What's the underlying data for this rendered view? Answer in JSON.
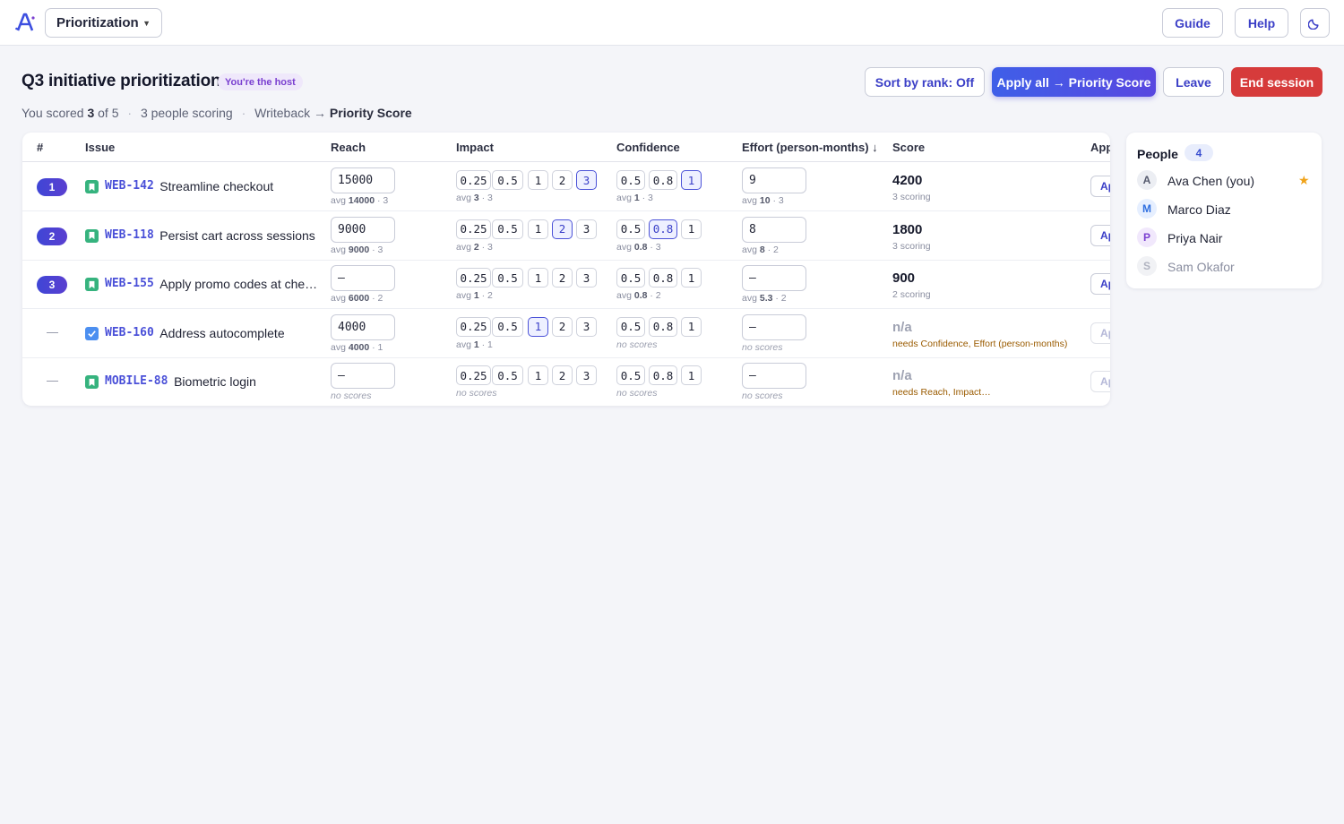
{
  "app": {
    "project_select": "Prioritization",
    "guide_label": "Guide",
    "help_label": "Help",
    "logo_icon": "app-logo-icon",
    "theme_icon": "moon-icon"
  },
  "header": {
    "title": "Q3 initiative prioritization",
    "host_badge": "You're the host",
    "scored_prefix": "You scored",
    "scored_count": "3",
    "scored_suffix": "of 5",
    "people_scoring": "3 people scoring",
    "writeback_label": "Writeback →",
    "writeback_target": "Priority Score",
    "sort_label": "Sort by rank: Off",
    "apply_label": "Apply all → Priority Score",
    "leave_label": "Leave",
    "end_label": "End session"
  },
  "table": {
    "columns": [
      "#",
      "Issue",
      "Reach",
      "Impact",
      "Confidence",
      "Effort (person-months) ↓",
      "Score",
      "App"
    ],
    "impact_options": [
      "0.25",
      "0.5",
      "1",
      "2",
      "3"
    ],
    "confidence_options": [
      "0.5",
      "0.8",
      "1"
    ],
    "apply_label": "Ap",
    "rows": [
      {
        "rank": "1",
        "type": "story",
        "key": "WEB-142",
        "title": "Streamline checkout",
        "reach": "15000",
        "reach_avg": "14000",
        "reach_n": "· 3",
        "impact_sel": 4,
        "impact_avg": "3",
        "impact_n": "· 3",
        "conf_sel": 2,
        "conf_avg": "1",
        "conf_n": "· 3",
        "effort": "9",
        "effort_avg": "10",
        "effort_n": "· 3",
        "score": "4200",
        "score_sub": "3 scoring",
        "score_warn": false
      },
      {
        "rank": "2",
        "type": "story",
        "key": "WEB-118",
        "title": "Persist cart across sessions",
        "reach": "9000",
        "reach_avg": "9000",
        "reach_n": "· 3",
        "impact_sel": 3,
        "impact_avg": "2",
        "impact_n": "· 3",
        "conf_sel": 1,
        "conf_avg": "0.8",
        "conf_n": "· 3",
        "effort": "8",
        "effort_avg": "8",
        "effort_n": "· 2",
        "score": "1800",
        "score_sub": "3 scoring",
        "score_warn": false
      },
      {
        "rank": "3",
        "type": "story",
        "key": "WEB-155",
        "title": "Apply promo codes at che…",
        "reach": "–",
        "reach_avg": "6000",
        "reach_n": "· 2",
        "impact_sel": -1,
        "impact_avg": "1",
        "impact_n": "· 2",
        "conf_sel": -1,
        "conf_avg": "0.8",
        "conf_n": "· 2",
        "effort": "–",
        "effort_avg": "5.3",
        "effort_n": "· 2",
        "score": "900",
        "score_sub": "2 scoring",
        "score_warn": false
      },
      {
        "rank": "—",
        "type": "task",
        "key": "WEB-160",
        "title": "Address autocomplete",
        "reach": "4000",
        "reach_avg": "4000",
        "reach_n": "· 1",
        "impact_sel": 2,
        "impact_avg": "1",
        "impact_n": "· 1",
        "conf_sel": -1,
        "conf_none": "no scores",
        "effort": "–",
        "effort_none": "no scores",
        "score": "n/a",
        "score_sub": "needs Confidence, Effort (person-months)",
        "score_warn": true
      },
      {
        "rank": "—",
        "type": "story",
        "key": "MOBILE-88",
        "title": "Biometric login",
        "reach": "–",
        "reach_none": "no scores",
        "impact_sel": -1,
        "impact_none": "no scores",
        "conf_sel": -1,
        "conf_none": "no scores",
        "effort": "–",
        "effort_none": "no scores",
        "score": "n/a",
        "score_sub": "needs Reach, Impact…",
        "score_warn": true
      }
    ]
  },
  "people": {
    "title": "People",
    "count": "4",
    "list": [
      {
        "initial": "A",
        "name": "Ava Chen (you)",
        "color": "#eceef3",
        "fg": "#555a6e",
        "active": true,
        "host": true
      },
      {
        "initial": "M",
        "name": "Marco Diaz",
        "color": "#e6efff",
        "fg": "#2f6fe0",
        "active": true,
        "host": false
      },
      {
        "initial": "P",
        "name": "Priya Nair",
        "color": "#f1e8fc",
        "fg": "#7a3fd0",
        "active": true,
        "host": false
      },
      {
        "initial": "S",
        "name": "Sam Okafor",
        "color": "#f1f2f5",
        "fg": "#b0b3c0",
        "active": false,
        "host": false
      }
    ]
  }
}
